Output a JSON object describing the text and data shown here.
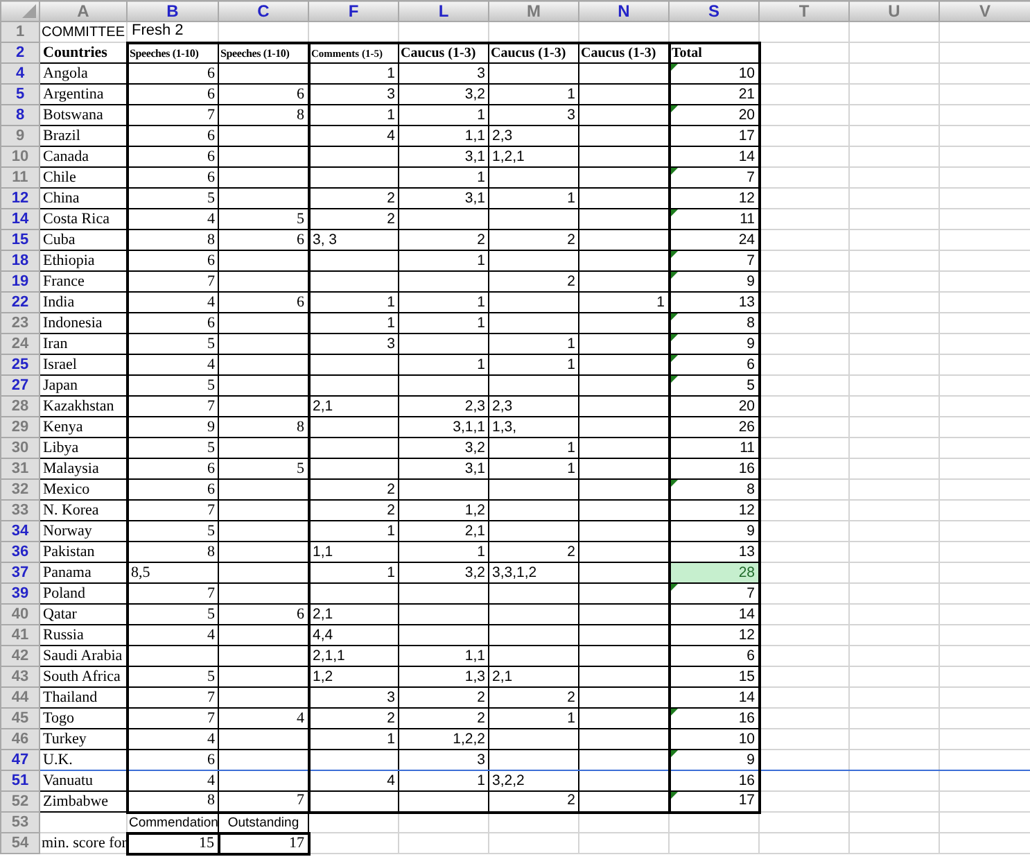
{
  "sheet": {
    "column_headers": [
      {
        "label": "A",
        "highlighted": false
      },
      {
        "label": "B",
        "highlighted": true
      },
      {
        "label": "C",
        "highlighted": true
      },
      {
        "label": "F",
        "highlighted": true
      },
      {
        "label": "L",
        "highlighted": true
      },
      {
        "label": "M",
        "highlighted": false
      },
      {
        "label": "N",
        "highlighted": true
      },
      {
        "label": "S",
        "highlighted": true
      },
      {
        "label": "T",
        "highlighted": false
      },
      {
        "label": "U",
        "highlighted": false
      },
      {
        "label": "V",
        "highlighted": false
      }
    ],
    "committee_row": {
      "number": "1",
      "highlighted": false,
      "label": "COMMITTEE",
      "value": "Fresh 2"
    },
    "header_row": {
      "number": "2",
      "highlighted": true,
      "headings": [
        "Countries",
        "Speeches (1-10)",
        "Speeches (1-10)",
        "Comments (1-5)",
        "Caucus (1-3)",
        "Caucus (1-3)",
        "Caucus (1-3)",
        "Total"
      ]
    },
    "countries": [
      {
        "number": "4",
        "highlighted": true,
        "country": "Angola",
        "scores": {
          "B": {
            "text": "6",
            "kind": "num"
          },
          "F": {
            "text": "1",
            "kind": "num"
          },
          "L": {
            "text": "3",
            "kind": "num"
          }
        },
        "total": {
          "text": "10",
          "flagged": true,
          "highlighted": false
        },
        "split_below": false
      },
      {
        "number": "5",
        "highlighted": true,
        "country": "Argentina",
        "scores": {
          "B": {
            "text": "6",
            "kind": "num"
          },
          "C": {
            "text": "6",
            "kind": "num"
          },
          "F": {
            "text": "3",
            "kind": "num"
          },
          "L": {
            "text": "3,2",
            "kind": "num"
          },
          "M": {
            "text": "1",
            "kind": "num"
          }
        },
        "total": {
          "text": "21",
          "flagged": false,
          "highlighted": false
        },
        "split_below": false
      },
      {
        "number": "8",
        "highlighted": true,
        "country": "Botswana",
        "scores": {
          "B": {
            "text": "7",
            "kind": "num"
          },
          "C": {
            "text": "8",
            "kind": "num"
          },
          "F": {
            "text": "1",
            "kind": "num"
          },
          "L": {
            "text": "1",
            "kind": "num"
          },
          "M": {
            "text": "3",
            "kind": "num"
          }
        },
        "total": {
          "text": "20",
          "flagged": true,
          "highlighted": false
        },
        "split_below": false
      },
      {
        "number": "9",
        "highlighted": false,
        "country": "Brazil",
        "scores": {
          "B": {
            "text": "6",
            "kind": "num"
          },
          "F": {
            "text": "4",
            "kind": "num"
          },
          "L": {
            "text": "1,1",
            "kind": "num"
          },
          "M": {
            "text": "2,3",
            "kind": "text"
          }
        },
        "total": {
          "text": "17",
          "flagged": false,
          "highlighted": false
        },
        "split_below": false
      },
      {
        "number": "10",
        "highlighted": false,
        "country": "Canada",
        "scores": {
          "B": {
            "text": "6",
            "kind": "num"
          },
          "L": {
            "text": "3,1",
            "kind": "num"
          },
          "M": {
            "text": "1,2,1",
            "kind": "text"
          }
        },
        "total": {
          "text": "14",
          "flagged": false,
          "highlighted": false
        },
        "split_below": false
      },
      {
        "number": "11",
        "highlighted": false,
        "country": "Chile",
        "scores": {
          "B": {
            "text": "6",
            "kind": "num"
          },
          "L": {
            "text": "1",
            "kind": "num"
          }
        },
        "total": {
          "text": "7",
          "flagged": true,
          "highlighted": false
        },
        "split_below": false
      },
      {
        "number": "12",
        "highlighted": true,
        "country": "China",
        "scores": {
          "B": {
            "text": "5",
            "kind": "num"
          },
          "F": {
            "text": "2",
            "kind": "num"
          },
          "L": {
            "text": "3,1",
            "kind": "num"
          },
          "M": {
            "text": "1",
            "kind": "num"
          }
        },
        "total": {
          "text": "12",
          "flagged": false,
          "highlighted": false
        },
        "split_below": false
      },
      {
        "number": "14",
        "highlighted": true,
        "country": "Costa Rica",
        "scores": {
          "B": {
            "text": "4",
            "kind": "num"
          },
          "C": {
            "text": "5",
            "kind": "num"
          },
          "F": {
            "text": "2",
            "kind": "num"
          }
        },
        "total": {
          "text": "11",
          "flagged": true,
          "highlighted": false
        },
        "split_below": false
      },
      {
        "number": "15",
        "highlighted": true,
        "country": "Cuba",
        "scores": {
          "B": {
            "text": "8",
            "kind": "num"
          },
          "C": {
            "text": "6",
            "kind": "num"
          },
          "F": {
            "text": "3, 3",
            "kind": "text"
          },
          "L": {
            "text": "2",
            "kind": "num"
          },
          "M": {
            "text": "2",
            "kind": "num"
          }
        },
        "total": {
          "text": "24",
          "flagged": false,
          "highlighted": false
        },
        "split_below": false
      },
      {
        "number": "18",
        "highlighted": true,
        "country": "Ethiopia",
        "scores": {
          "B": {
            "text": "6",
            "kind": "num"
          },
          "L": {
            "text": "1",
            "kind": "num"
          }
        },
        "total": {
          "text": "7",
          "flagged": true,
          "highlighted": false
        },
        "split_below": false
      },
      {
        "number": "19",
        "highlighted": true,
        "country": "France",
        "scores": {
          "B": {
            "text": "7",
            "kind": "num"
          },
          "M": {
            "text": "2",
            "kind": "num"
          }
        },
        "total": {
          "text": "9",
          "flagged": true,
          "highlighted": false
        },
        "split_below": false
      },
      {
        "number": "22",
        "highlighted": true,
        "country": "India",
        "scores": {
          "B": {
            "text": "4",
            "kind": "num"
          },
          "C": {
            "text": "6",
            "kind": "num"
          },
          "F": {
            "text": "1",
            "kind": "num"
          },
          "L": {
            "text": "1",
            "kind": "num"
          },
          "N": {
            "text": "1",
            "kind": "num"
          }
        },
        "total": {
          "text": "13",
          "flagged": false,
          "highlighted": false
        },
        "split_below": false
      },
      {
        "number": "23",
        "highlighted": false,
        "country": "Indonesia",
        "scores": {
          "B": {
            "text": "6",
            "kind": "num"
          },
          "F": {
            "text": "1",
            "kind": "num"
          },
          "L": {
            "text": "1",
            "kind": "num"
          }
        },
        "total": {
          "text": "8",
          "flagged": true,
          "highlighted": false
        },
        "split_below": false
      },
      {
        "number": "24",
        "highlighted": false,
        "country": "Iran",
        "scores": {
          "B": {
            "text": "5",
            "kind": "num"
          },
          "F": {
            "text": "3",
            "kind": "num"
          },
          "M": {
            "text": "1",
            "kind": "num"
          }
        },
        "total": {
          "text": "9",
          "flagged": true,
          "highlighted": false
        },
        "split_below": false
      },
      {
        "number": "25",
        "highlighted": true,
        "country": "Israel",
        "scores": {
          "B": {
            "text": "4",
            "kind": "num"
          },
          "L": {
            "text": "1",
            "kind": "num"
          },
          "M": {
            "text": "1",
            "kind": "num"
          }
        },
        "total": {
          "text": "6",
          "flagged": true,
          "highlighted": false
        },
        "split_below": false
      },
      {
        "number": "27",
        "highlighted": true,
        "country": "Japan",
        "scores": {
          "B": {
            "text": "5",
            "kind": "num"
          }
        },
        "total": {
          "text": "5",
          "flagged": true,
          "highlighted": false
        },
        "split_below": false
      },
      {
        "number": "28",
        "highlighted": false,
        "country": "Kazakhstan",
        "scores": {
          "B": {
            "text": "7",
            "kind": "num"
          },
          "F": {
            "text": "2,1",
            "kind": "text"
          },
          "L": {
            "text": "2,3",
            "kind": "num"
          },
          "M": {
            "text": "2,3",
            "kind": "text"
          }
        },
        "total": {
          "text": "20",
          "flagged": false,
          "highlighted": false
        },
        "split_below": false
      },
      {
        "number": "29",
        "highlighted": false,
        "country": "Kenya",
        "scores": {
          "B": {
            "text": "9",
            "kind": "num"
          },
          "C": {
            "text": "8",
            "kind": "num"
          },
          "L": {
            "text": "3,1,1",
            "kind": "num"
          },
          "M": {
            "text": "1,3,",
            "kind": "text"
          }
        },
        "total": {
          "text": "26",
          "flagged": false,
          "highlighted": false
        },
        "split_below": false
      },
      {
        "number": "30",
        "highlighted": false,
        "country": "Libya",
        "scores": {
          "B": {
            "text": "5",
            "kind": "num"
          },
          "L": {
            "text": "3,2",
            "kind": "num"
          },
          "M": {
            "text": "1",
            "kind": "num"
          }
        },
        "total": {
          "text": "11",
          "flagged": false,
          "highlighted": false
        },
        "split_below": false
      },
      {
        "number": "31",
        "highlighted": false,
        "country": "Malaysia",
        "scores": {
          "B": {
            "text": "6",
            "kind": "num"
          },
          "C": {
            "text": "5",
            "kind": "num"
          },
          "L": {
            "text": "3,1",
            "kind": "num"
          },
          "M": {
            "text": "1",
            "kind": "num"
          }
        },
        "total": {
          "text": "16",
          "flagged": false,
          "highlighted": false
        },
        "split_below": false
      },
      {
        "number": "32",
        "highlighted": false,
        "country": "Mexico",
        "scores": {
          "B": {
            "text": "6",
            "kind": "num"
          },
          "F": {
            "text": "2",
            "kind": "num"
          }
        },
        "total": {
          "text": "8",
          "flagged": true,
          "highlighted": false
        },
        "split_below": false
      },
      {
        "number": "33",
        "highlighted": false,
        "country": "N. Korea",
        "scores": {
          "B": {
            "text": "7",
            "kind": "num"
          },
          "F": {
            "text": "2",
            "kind": "num"
          },
          "L": {
            "text": "1,2",
            "kind": "num"
          }
        },
        "total": {
          "text": "12",
          "flagged": false,
          "highlighted": false
        },
        "split_below": false
      },
      {
        "number": "34",
        "highlighted": true,
        "country": "Norway",
        "scores": {
          "B": {
            "text": "5",
            "kind": "num"
          },
          "F": {
            "text": "1",
            "kind": "num"
          },
          "L": {
            "text": "2,1",
            "kind": "num"
          }
        },
        "total": {
          "text": "9",
          "flagged": false,
          "highlighted": false
        },
        "split_below": false
      },
      {
        "number": "36",
        "highlighted": true,
        "country": "Pakistan",
        "scores": {
          "B": {
            "text": "8",
            "kind": "num"
          },
          "F": {
            "text": "1,1",
            "kind": "text"
          },
          "L": {
            "text": "1",
            "kind": "num"
          },
          "M": {
            "text": "2",
            "kind": "num"
          }
        },
        "total": {
          "text": "13",
          "flagged": false,
          "highlighted": false
        },
        "split_below": false
      },
      {
        "number": "37",
        "highlighted": true,
        "country": "Panama",
        "scores": {
          "B": {
            "text": "8,5",
            "kind": "text"
          },
          "F": {
            "text": "1",
            "kind": "num"
          },
          "L": {
            "text": "3,2",
            "kind": "num"
          },
          "M": {
            "text": "3,3,1,2",
            "kind": "text"
          }
        },
        "total": {
          "text": "28",
          "flagged": false,
          "highlighted": true
        },
        "split_below": false
      },
      {
        "number": "39",
        "highlighted": true,
        "country": "Poland",
        "scores": {
          "B": {
            "text": "7",
            "kind": "num"
          }
        },
        "total": {
          "text": "7",
          "flagged": true,
          "highlighted": false
        },
        "split_below": false
      },
      {
        "number": "40",
        "highlighted": false,
        "country": "Qatar",
        "scores": {
          "B": {
            "text": "5",
            "kind": "num"
          },
          "C": {
            "text": "6",
            "kind": "num"
          },
          "F": {
            "text": "2,1",
            "kind": "text"
          }
        },
        "total": {
          "text": "14",
          "flagged": false,
          "highlighted": false
        },
        "split_below": false
      },
      {
        "number": "41",
        "highlighted": false,
        "country": "Russia",
        "scores": {
          "B": {
            "text": "4",
            "kind": "num"
          },
          "F": {
            "text": "4,4",
            "kind": "text"
          }
        },
        "total": {
          "text": "12",
          "flagged": false,
          "highlighted": false
        },
        "split_below": false
      },
      {
        "number": "42",
        "highlighted": false,
        "country": "Saudi Arabia",
        "scores": {
          "F": {
            "text": "2,1,1",
            "kind": "text"
          },
          "L": {
            "text": "1,1",
            "kind": "num"
          }
        },
        "total": {
          "text": "6",
          "flagged": false,
          "highlighted": false
        },
        "split_below": false
      },
      {
        "number": "43",
        "highlighted": false,
        "country": "South Africa",
        "scores": {
          "B": {
            "text": "5",
            "kind": "num"
          },
          "F": {
            "text": "1,2",
            "kind": "text"
          },
          "L": {
            "text": "1,3",
            "kind": "num"
          },
          "M": {
            "text": "2,1",
            "kind": "text"
          }
        },
        "total": {
          "text": "15",
          "flagged": false,
          "highlighted": false
        },
        "split_below": false
      },
      {
        "number": "44",
        "highlighted": false,
        "country": "Thailand",
        "scores": {
          "B": {
            "text": "7",
            "kind": "num"
          },
          "F": {
            "text": "3",
            "kind": "num"
          },
          "L": {
            "text": "2",
            "kind": "num"
          },
          "M": {
            "text": "2",
            "kind": "num"
          }
        },
        "total": {
          "text": "14",
          "flagged": false,
          "highlighted": false
        },
        "split_below": false
      },
      {
        "number": "45",
        "highlighted": false,
        "country": "Togo",
        "scores": {
          "B": {
            "text": "7",
            "kind": "num"
          },
          "C": {
            "text": "4",
            "kind": "num"
          },
          "F": {
            "text": "2",
            "kind": "num"
          },
          "L": {
            "text": "2",
            "kind": "num"
          },
          "M": {
            "text": "1",
            "kind": "num"
          }
        },
        "total": {
          "text": "16",
          "flagged": true,
          "highlighted": false
        },
        "split_below": false
      },
      {
        "number": "46",
        "highlighted": false,
        "country": "Turkey",
        "scores": {
          "B": {
            "text": "4",
            "kind": "num"
          },
          "F": {
            "text": "1",
            "kind": "num"
          },
          "L": {
            "text": "1,2,2",
            "kind": "num"
          }
        },
        "total": {
          "text": "10",
          "flagged": false,
          "highlighted": false
        },
        "split_below": false
      },
      {
        "number": "47",
        "highlighted": true,
        "country": "U.K.",
        "scores": {
          "B": {
            "text": "6",
            "kind": "num"
          },
          "L": {
            "text": "3",
            "kind": "num"
          }
        },
        "total": {
          "text": "9",
          "flagged": true,
          "highlighted": false
        },
        "split_below": true
      },
      {
        "number": "51",
        "highlighted": true,
        "country": "Vanuatu",
        "scores": {
          "B": {
            "text": "4",
            "kind": "num"
          },
          "F": {
            "text": "4",
            "kind": "num"
          },
          "L": {
            "text": "1",
            "kind": "num"
          },
          "M": {
            "text": "3,2,2",
            "kind": "text"
          }
        },
        "total": {
          "text": "16",
          "flagged": false,
          "highlighted": false
        },
        "split_below": false
      },
      {
        "number": "52",
        "highlighted": false,
        "country": "Zimbabwe",
        "scores": {
          "B": {
            "text": "8",
            "kind": "num"
          },
          "C": {
            "text": "7",
            "kind": "num"
          },
          "M": {
            "text": "2",
            "kind": "num"
          }
        },
        "total": {
          "text": "17",
          "flagged": true,
          "highlighted": false
        },
        "split_below": false
      }
    ],
    "award_labels_row": {
      "number": "53",
      "highlighted": false,
      "labels": [
        "Commendation",
        "Outstanding"
      ]
    },
    "min_score_row": {
      "number": "54",
      "highlighted": false,
      "label": "min. score for",
      "values": [
        "15",
        "17"
      ]
    }
  }
}
